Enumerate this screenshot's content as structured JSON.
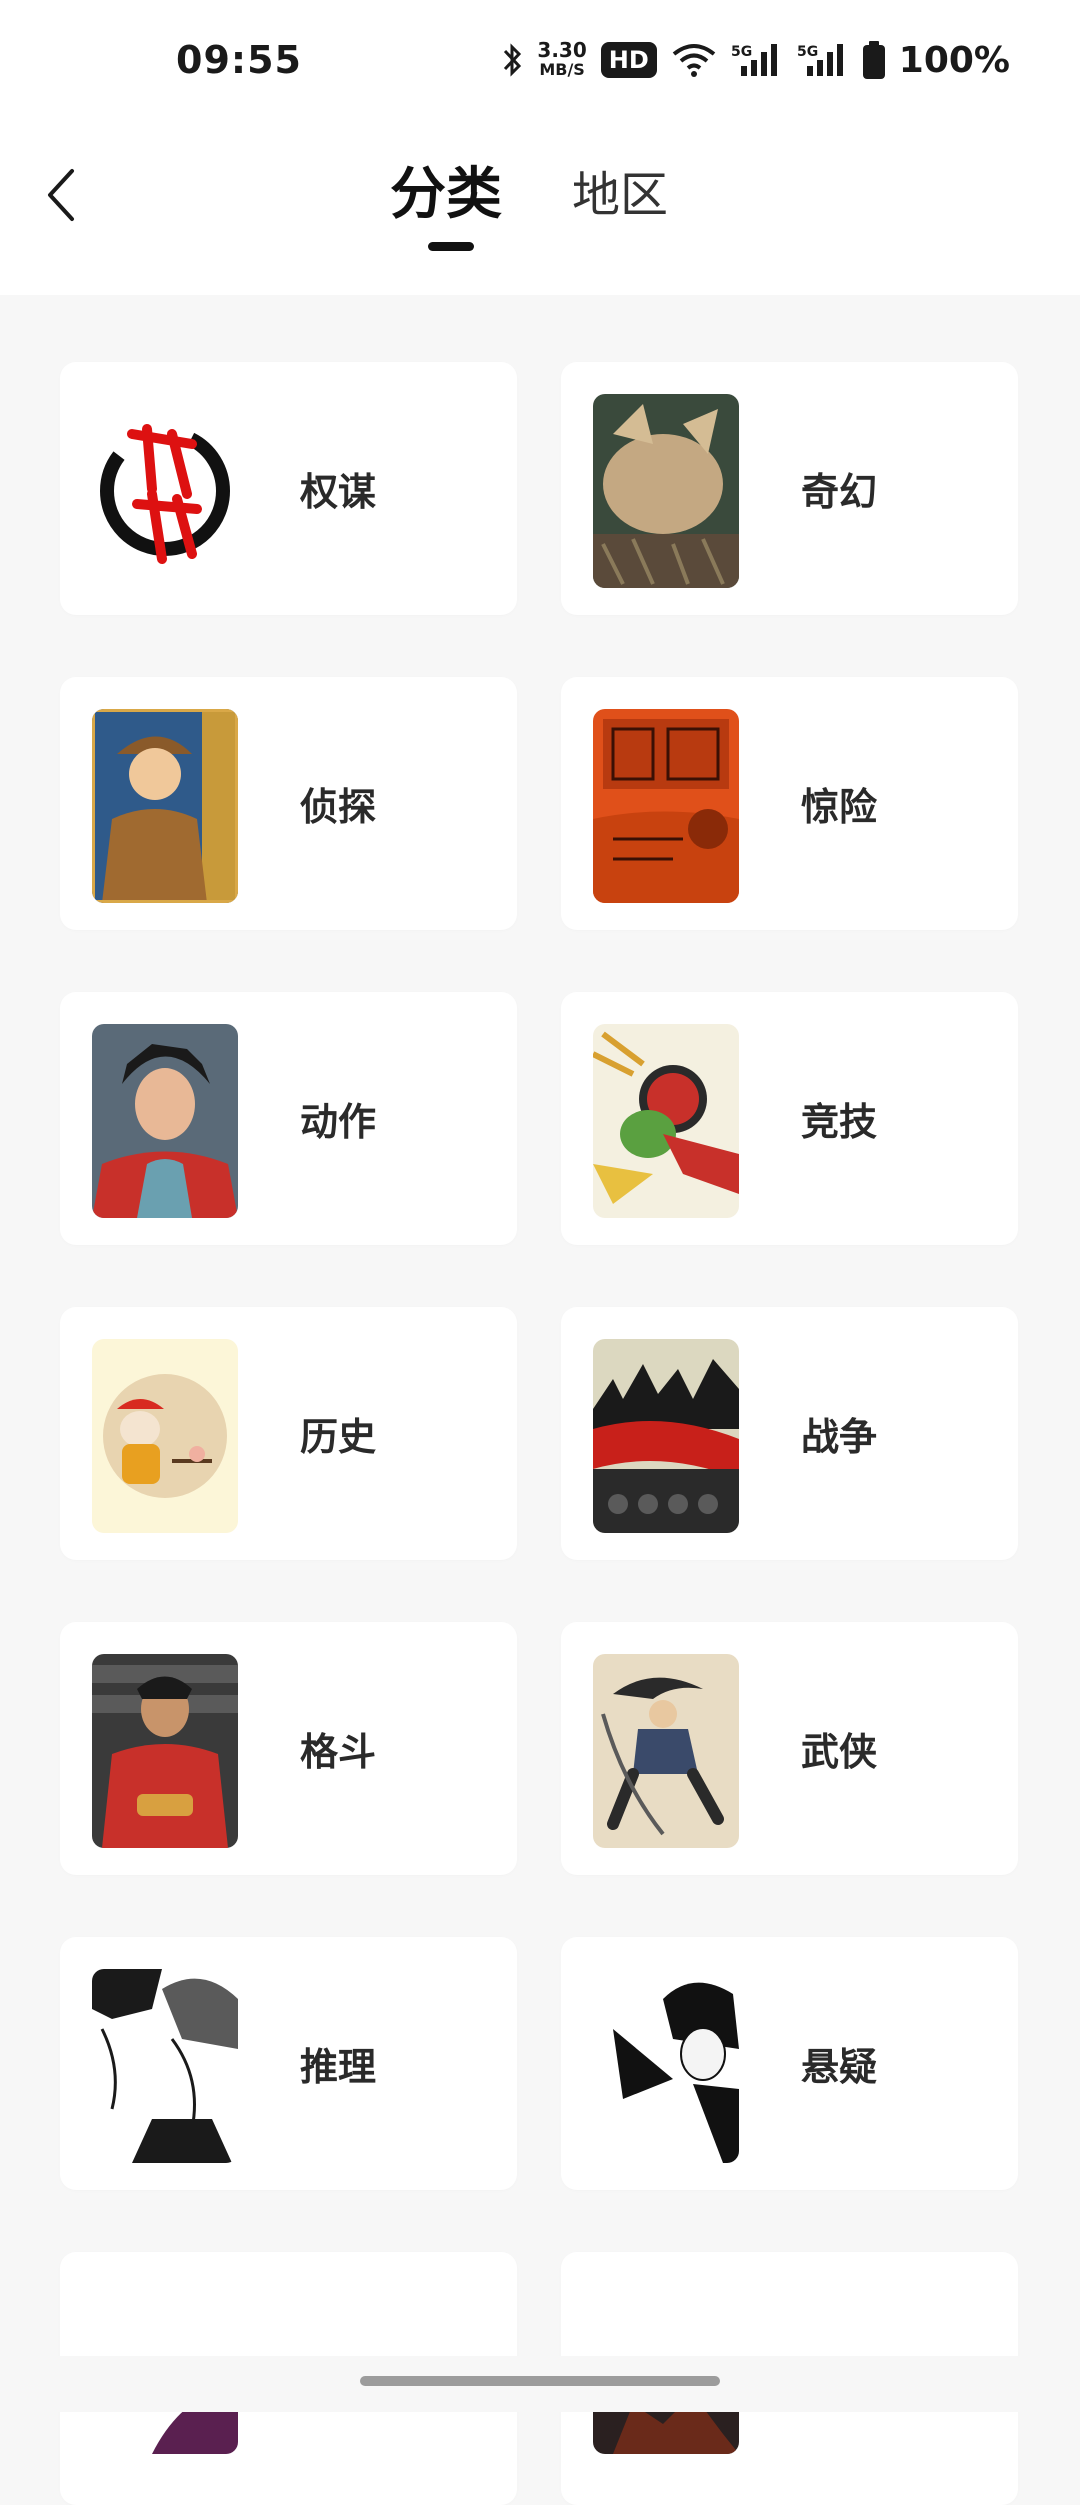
{
  "status_bar": {
    "time": "09:55",
    "speed_value": "3.30",
    "speed_unit": "MB/S",
    "hd_label": "HD",
    "network_1": "5G",
    "network_2": "5G",
    "battery": "100%"
  },
  "header": {
    "tabs": [
      {
        "label": "分类",
        "active": true
      },
      {
        "label": "地区",
        "active": false
      }
    ]
  },
  "categories": [
    {
      "label": "权谋",
      "icon": "thumbnail-quanmou"
    },
    {
      "label": "奇幻",
      "icon": "thumbnail-qihuan"
    },
    {
      "label": "侦探",
      "icon": "thumbnail-zhentan"
    },
    {
      "label": "惊险",
      "icon": "thumbnail-jingxian"
    },
    {
      "label": "动作",
      "icon": "thumbnail-dongzuo"
    },
    {
      "label": "竞技",
      "icon": "thumbnail-jingji"
    },
    {
      "label": "历史",
      "icon": "thumbnail-lishi"
    },
    {
      "label": "战争",
      "icon": "thumbnail-zhanzheng"
    },
    {
      "label": "格斗",
      "icon": "thumbnail-gedou"
    },
    {
      "label": "武侠",
      "icon": "thumbnail-wuxia"
    },
    {
      "label": "推理",
      "icon": "thumbnail-tuili"
    },
    {
      "label": "悬疑",
      "icon": "thumbnail-xuanyi"
    },
    {
      "label": "",
      "icon": "thumbnail-partial-1"
    },
    {
      "label": "",
      "icon": "thumbnail-partial-2"
    }
  ]
}
